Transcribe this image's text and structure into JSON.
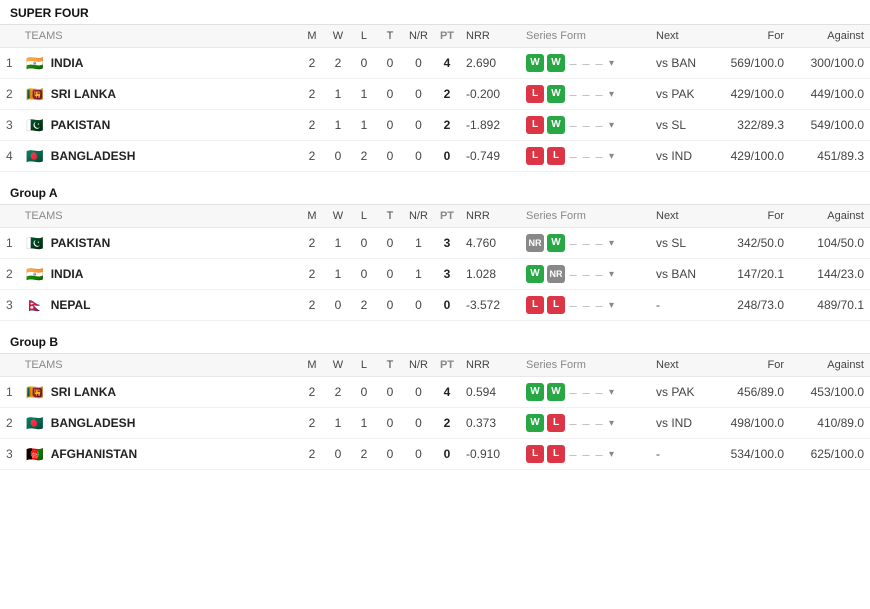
{
  "sections": [
    {
      "id": "super-four",
      "title": "SUPER FOUR",
      "columns": [
        "TEAMS",
        "M",
        "W",
        "L",
        "T",
        "N/R",
        "PT",
        "NRR",
        "Series Form",
        "Next",
        "For",
        "Against"
      ],
      "rows": [
        {
          "pos": "1",
          "team": "INDIA",
          "flag": "🇮🇳",
          "m": "2",
          "w": "2",
          "l": "0",
          "t": "0",
          "nr": "0",
          "pt": "4",
          "nrr": "2.690",
          "form": [
            "W",
            "W",
            "-",
            "-",
            "-"
          ],
          "next": "vs BAN",
          "for": "569/100.0",
          "against": "300/100.0"
        },
        {
          "pos": "2",
          "team": "SRI LANKA",
          "flag": "🇱🇰",
          "m": "2",
          "w": "1",
          "l": "1",
          "t": "0",
          "nr": "0",
          "pt": "2",
          "nrr": "-0.200",
          "form": [
            "L",
            "W",
            "-",
            "-",
            "-"
          ],
          "next": "vs PAK",
          "for": "429/100.0",
          "against": "449/100.0"
        },
        {
          "pos": "3",
          "team": "PAKISTAN",
          "flag": "🇵🇰",
          "m": "2",
          "w": "1",
          "l": "1",
          "t": "0",
          "nr": "0",
          "pt": "2",
          "nrr": "-1.892",
          "form": [
            "L",
            "W",
            "-",
            "-",
            "-"
          ],
          "next": "vs SL",
          "for": "322/89.3",
          "against": "549/100.0"
        },
        {
          "pos": "4",
          "team": "BANGLADESH",
          "flag": "🇧🇩",
          "m": "2",
          "w": "0",
          "l": "2",
          "t": "0",
          "nr": "0",
          "pt": "0",
          "nrr": "-0.749",
          "form": [
            "L",
            "L",
            "-",
            "-",
            "-"
          ],
          "next": "vs IND",
          "for": "429/100.0",
          "against": "451/89.3"
        }
      ]
    },
    {
      "id": "group-a",
      "title": "Group A",
      "columns": [
        "TEAMS",
        "M",
        "W",
        "L",
        "T",
        "N/R",
        "PT",
        "NRR",
        "Series Form",
        "Next",
        "For",
        "Against"
      ],
      "rows": [
        {
          "pos": "1",
          "team": "PAKISTAN",
          "flag": "🇵🇰",
          "m": "2",
          "w": "1",
          "l": "0",
          "t": "0",
          "nr": "1",
          "pt": "3",
          "nrr": "4.760",
          "form": [
            "NR",
            "W",
            "-",
            "-",
            "-"
          ],
          "next": "vs SL",
          "for": "342/50.0",
          "against": "104/50.0"
        },
        {
          "pos": "2",
          "team": "INDIA",
          "flag": "🇮🇳",
          "m": "2",
          "w": "1",
          "l": "0",
          "t": "0",
          "nr": "1",
          "pt": "3",
          "nrr": "1.028",
          "form": [
            "W",
            "NR",
            "-",
            "-",
            "-"
          ],
          "next": "vs BAN",
          "for": "147/20.1",
          "against": "144/23.0"
        },
        {
          "pos": "3",
          "team": "NEPAL",
          "flag": "🇳🇵",
          "m": "2",
          "w": "0",
          "l": "2",
          "t": "0",
          "nr": "0",
          "pt": "0",
          "nrr": "-3.572",
          "form": [
            "L",
            "L",
            "-",
            "-",
            "-"
          ],
          "next": "-",
          "for": "248/73.0",
          "against": "489/70.1"
        }
      ]
    },
    {
      "id": "group-b",
      "title": "Group B",
      "columns": [
        "TEAMS",
        "M",
        "W",
        "L",
        "T",
        "N/R",
        "PT",
        "NRR",
        "Series Form",
        "Next",
        "For",
        "Against"
      ],
      "rows": [
        {
          "pos": "1",
          "team": "SRI LANKA",
          "flag": "🇱🇰",
          "m": "2",
          "w": "2",
          "l": "0",
          "t": "0",
          "nr": "0",
          "pt": "4",
          "nrr": "0.594",
          "form": [
            "W",
            "W",
            "-",
            "-",
            "-"
          ],
          "next": "vs PAK",
          "for": "456/89.0",
          "against": "453/100.0"
        },
        {
          "pos": "2",
          "team": "BANGLADESH",
          "flag": "🇧🇩",
          "m": "2",
          "w": "1",
          "l": "1",
          "t": "0",
          "nr": "0",
          "pt": "2",
          "nrr": "0.373",
          "form": [
            "W",
            "L",
            "-",
            "-",
            "-"
          ],
          "next": "vs IND",
          "for": "498/100.0",
          "against": "410/89.0"
        },
        {
          "pos": "3",
          "team": "AFGHANISTAN",
          "flag": "🇦🇫",
          "m": "2",
          "w": "0",
          "l": "2",
          "t": "0",
          "nr": "0",
          "pt": "0",
          "nrr": "-0.910",
          "form": [
            "L",
            "L",
            "-",
            "-",
            "-"
          ],
          "next": "-",
          "for": "534/100.0",
          "against": "625/100.0"
        }
      ]
    }
  ]
}
